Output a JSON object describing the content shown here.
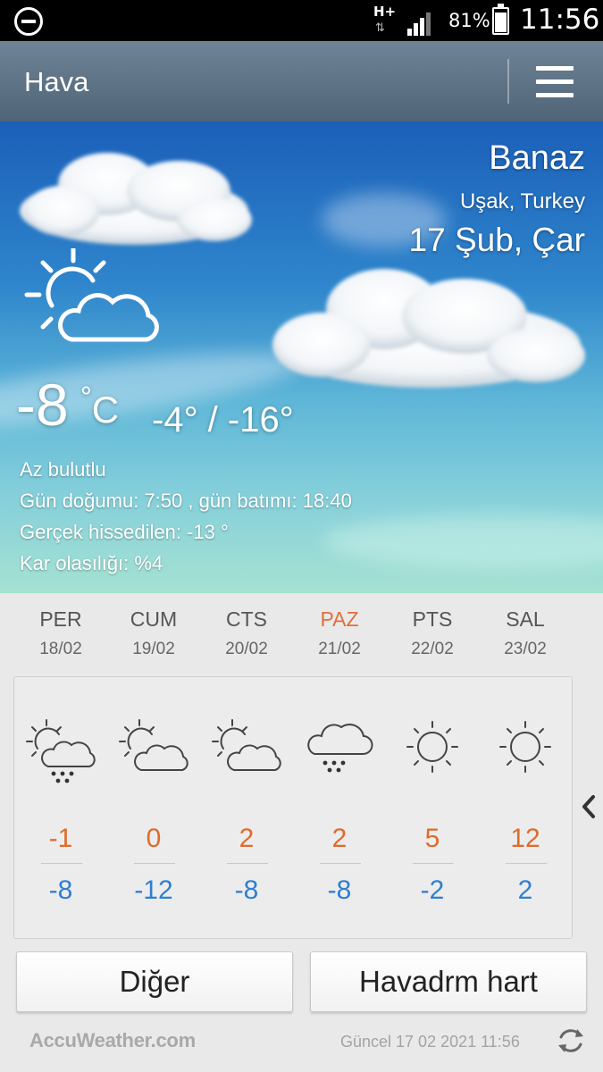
{
  "status_bar": {
    "network": "H+",
    "battery_percent": "81%",
    "battery_level": 0.81,
    "time": "11:56"
  },
  "app_bar": {
    "title": "Hava",
    "menu_icon": "hamburger-menu-icon"
  },
  "current": {
    "city": "Banaz",
    "region": "Uşak, Turkey",
    "date": "17 Şub, Çar",
    "temp": "-8",
    "unit": "C",
    "hilo": "-4° / -16°",
    "condition": "Az bulutlu",
    "sun": "Gün doğumu: 7:50 , gün batımı: 18:40",
    "feels_like": "Gerçek hissedilen: -13 °",
    "snow_chance": "Kar olasılığı: %4",
    "icon": "partly-cloudy-icon"
  },
  "forecast": [
    {
      "day": "PER",
      "date": "18/02",
      "high": "-1",
      "low": "-8",
      "icon": "partly-cloudy-snow-icon",
      "weekend": false
    },
    {
      "day": "CUM",
      "date": "19/02",
      "high": "0",
      "low": "-12",
      "icon": "partly-cloudy-icon",
      "weekend": false
    },
    {
      "day": "CTS",
      "date": "20/02",
      "high": "2",
      "low": "-8",
      "icon": "partly-cloudy-icon",
      "weekend": false
    },
    {
      "day": "PAZ",
      "date": "21/02",
      "high": "2",
      "low": "-8",
      "icon": "snow-cloud-icon",
      "weekend": true
    },
    {
      "day": "PTS",
      "date": "22/02",
      "high": "5",
      "low": "-2",
      "icon": "sun-icon",
      "weekend": false
    },
    {
      "day": "SAL",
      "date": "23/02",
      "high": "12",
      "low": "2",
      "icon": "sun-icon",
      "weekend": false
    }
  ],
  "colors": {
    "high": "#e06b2b",
    "low": "#2f7fd0",
    "weekend_day": "#e0703c",
    "app_bar": "#5a6f82"
  },
  "buttons": {
    "more": "Diğer",
    "map": "Havadrm hart"
  },
  "footer": {
    "brand": "AccuWeather.com",
    "updated": "Güncel 17 02 2021 11:56"
  }
}
